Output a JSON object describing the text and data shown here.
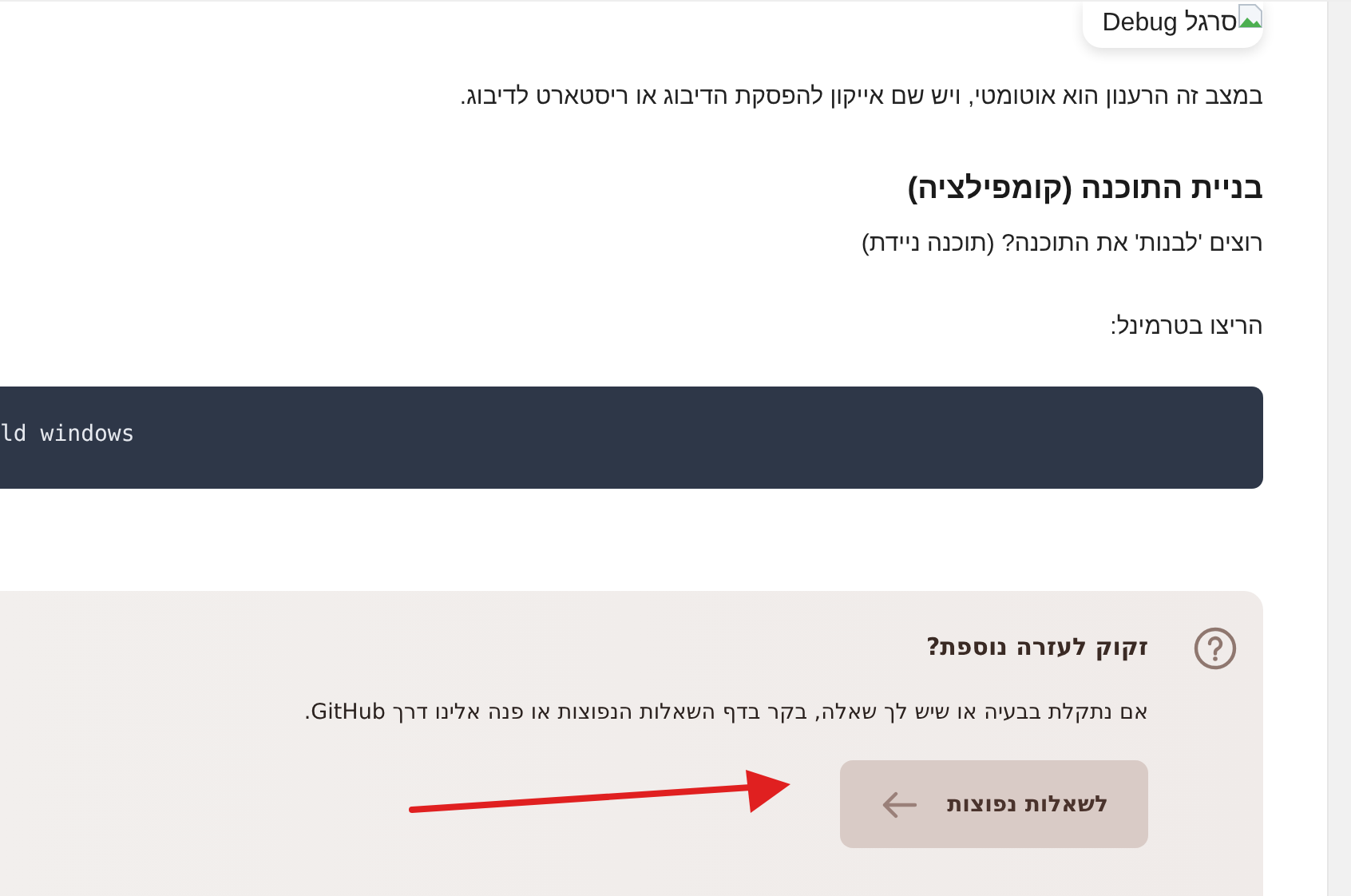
{
  "image_alt": "סרגל Debug",
  "paragraphs": [
    {
      "kind": "text",
      "text": "במצב זה הרענון הוא אוטומטי, ויש שם אייקון להפסקת הדיבוג או ריסטארט לדיבוג."
    },
    {
      "kind": "heading",
      "text": "בניית התוכנה (קומפילציה)"
    },
    {
      "kind": "text",
      "text": "רוצים 'לבנות' את התוכנה? (תוכנה ניידת)"
    },
    {
      "kind": "text",
      "text": "הריצו בטרמינל:"
    },
    {
      "kind": "code",
      "text": "ld windows"
    }
  ],
  "help": {
    "title": "זקוק לעזרה נוספת?",
    "text": "אם נתקלת בבעיה או שיש לך שאלה, בקר בדף השאלות הנפוצות או פנה אלינו דרך GitHub.",
    "button": "לשאלות נפוצות"
  }
}
